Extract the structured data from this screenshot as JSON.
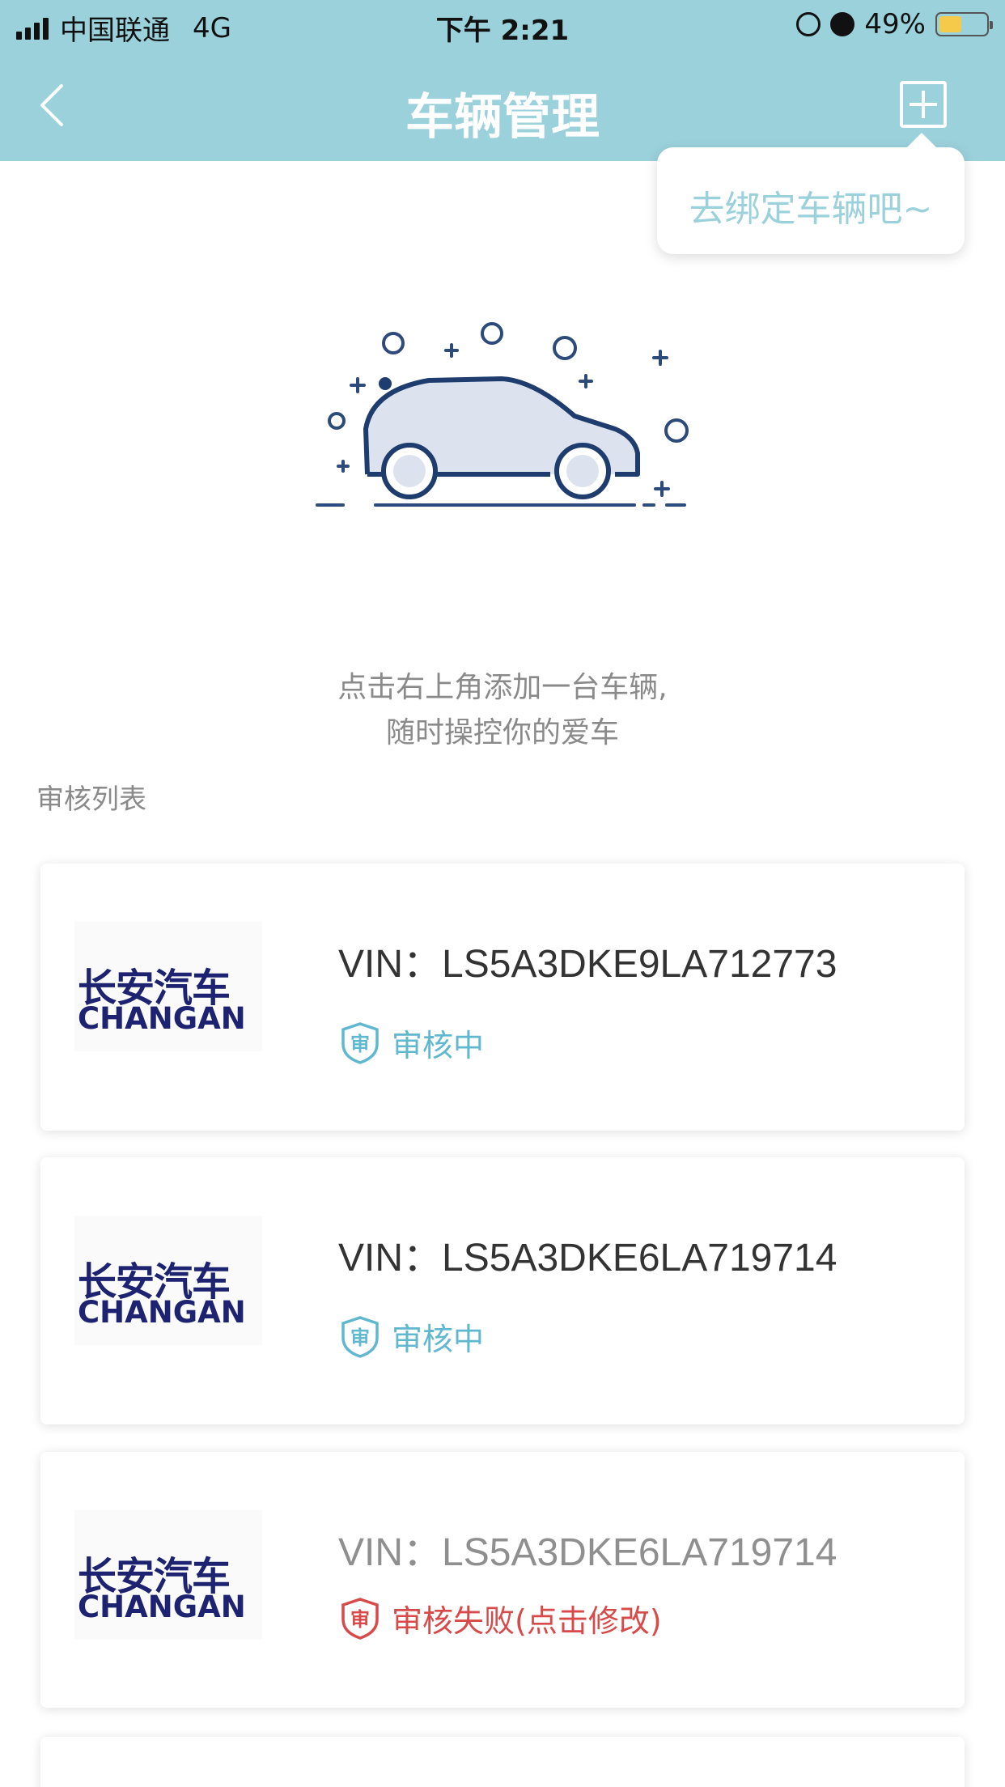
{
  "status_bar": {
    "carrier": "中国联通",
    "network": "4G",
    "time": "下午 2:21",
    "battery": "49%",
    "battery_level": 0.49
  },
  "nav": {
    "title": "车辆管理",
    "back_icon": "chevron-left-icon",
    "add_icon": "plus-square-icon"
  },
  "tooltip": {
    "text": "去绑定车辆吧~"
  },
  "empty_state": {
    "line1": "点击右上角添加一台车辆,",
    "line2": "随时操控你的爱车"
  },
  "review": {
    "section_label": "审核列表",
    "items": [
      {
        "logo_zh": "长安汽车",
        "logo_en": "CHANGAN",
        "vin_label": "VIN：",
        "vin": "LS5A3DKE9LA712773",
        "status": "审核中",
        "shield_char": "审",
        "state": "pending"
      },
      {
        "logo_zh": "长安汽车",
        "logo_en": "CHANGAN",
        "vin_label": "VIN：",
        "vin": "LS5A3DKE6LA719714",
        "status": "审核中",
        "shield_char": "审",
        "state": "pending"
      },
      {
        "logo_zh": "长安汽车",
        "logo_en": "CHANGAN",
        "vin_label": "VIN：",
        "vin": "LS5A3DKE6LA719714",
        "status": "审核失败(点击修改)",
        "shield_char": "审",
        "state": "failed"
      }
    ]
  },
  "colors": {
    "header": "#9bd1db",
    "pending": "#5fb8cf",
    "failed": "#d84a4a",
    "brand_navy": "#1d2370"
  }
}
